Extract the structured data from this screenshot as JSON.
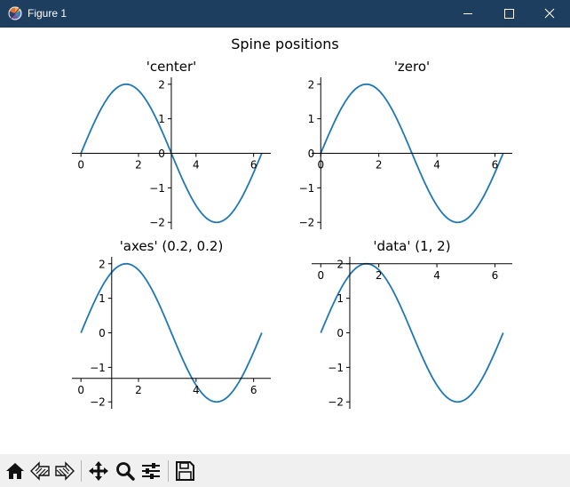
{
  "window": {
    "title": "Figure 1",
    "controls": [
      "minimize-icon",
      "maximize-icon",
      "close-icon"
    ]
  },
  "figure": {
    "suptitle": "Spine positions"
  },
  "toolbar": {
    "buttons": [
      "home-icon",
      "back-icon",
      "forward-icon",
      "pan-icon",
      "zoom-icon",
      "configure-subplots-icon",
      "save-icon"
    ]
  },
  "colors": {
    "titlebar": "#1d3e5e",
    "line": "#1f77b4",
    "toolbar": "#f0f0f0"
  },
  "chart_data": [
    {
      "type": "line",
      "title": "'center'",
      "function": "2*sin(x)",
      "x_range": [
        0,
        6.283
      ],
      "xlim": [
        -0.314,
        6.597
      ],
      "ylim": [
        -2.2,
        2.2
      ],
      "x_ticks": [
        0,
        2,
        4,
        6
      ],
      "y_ticks": [
        -2,
        -1,
        0,
        1,
        2
      ],
      "x_tick_labels": [
        "0",
        "2",
        "4",
        "6"
      ],
      "y_tick_labels": [
        "−2",
        "−1",
        "0",
        "1",
        "2"
      ],
      "left_spine_at_x": 3.14,
      "bottom_spine_at_y": 0
    },
    {
      "type": "line",
      "title": "'zero'",
      "function": "2*sin(x)",
      "x_range": [
        0,
        6.283
      ],
      "xlim": [
        -0.314,
        6.597
      ],
      "ylim": [
        -2.2,
        2.2
      ],
      "x_ticks": [
        0,
        2,
        4,
        6
      ],
      "y_ticks": [
        -2,
        -1,
        0,
        1,
        2
      ],
      "x_tick_labels": [
        "0",
        "2",
        "4",
        "6"
      ],
      "y_tick_labels": [
        "−2",
        "−1",
        "0",
        "1",
        "2"
      ],
      "left_spine_at_x": 0,
      "bottom_spine_at_y": 0
    },
    {
      "type": "line",
      "title": "'axes' (0.2, 0.2)",
      "function": "2*sin(x)",
      "x_range": [
        0,
        6.283
      ],
      "xlim": [
        -0.314,
        6.597
      ],
      "ylim": [
        -2.2,
        2.2
      ],
      "x_ticks": [
        0,
        2,
        4,
        6
      ],
      "y_ticks": [
        -2,
        -1,
        0,
        1,
        2
      ],
      "x_tick_labels": [
        "0",
        "2",
        "4",
        "6"
      ],
      "y_tick_labels": [
        "−2",
        "−1",
        "0",
        "1",
        "2"
      ],
      "left_spine_at_x": 1.068,
      "bottom_spine_at_y": -1.32
    },
    {
      "type": "line",
      "title": "'data' (1, 2)",
      "function": "2*sin(x)",
      "x_range": [
        0,
        6.283
      ],
      "xlim": [
        -0.314,
        6.597
      ],
      "ylim": [
        -2.2,
        2.2
      ],
      "x_ticks": [
        0,
        2,
        4,
        6
      ],
      "y_ticks": [
        -2,
        -1,
        0,
        1,
        2
      ],
      "x_tick_labels": [
        "0",
        "2",
        "4",
        "6"
      ],
      "y_tick_labels": [
        "−2",
        "−1",
        "0",
        "1",
        "2"
      ],
      "left_spine_at_x": 1,
      "bottom_spine_at_y": 2
    }
  ]
}
